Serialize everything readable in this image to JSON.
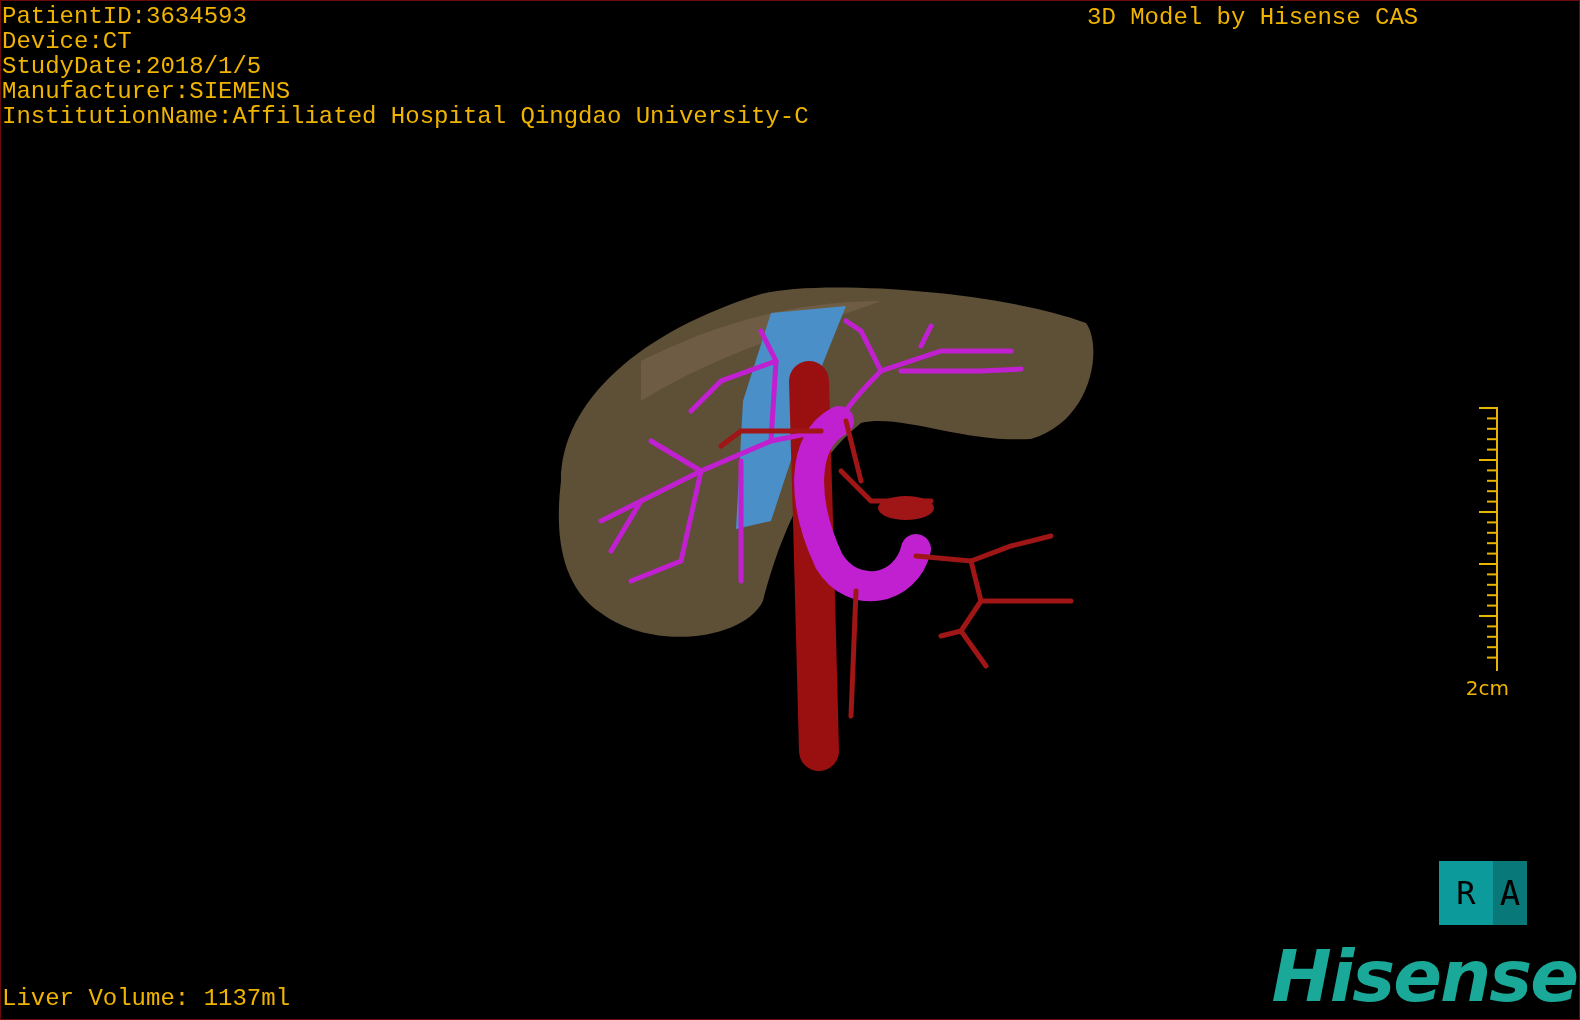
{
  "patient_info": [
    "PatientID:3634593",
    "Device:CT",
    "StudyDate:2018/1/5",
    "Manufacturer:SIEMENS",
    "InstitutionName:Affiliated Hospital Qingdao University-C"
  ],
  "model_credit": "3D Model by Hisense CAS",
  "scale_bar": {
    "label": "2cm"
  },
  "orientation_cube": {
    "faces": [
      "R",
      "A"
    ]
  },
  "logo": "Hisense",
  "liver_volume": "Liver Volume: 1137ml"
}
